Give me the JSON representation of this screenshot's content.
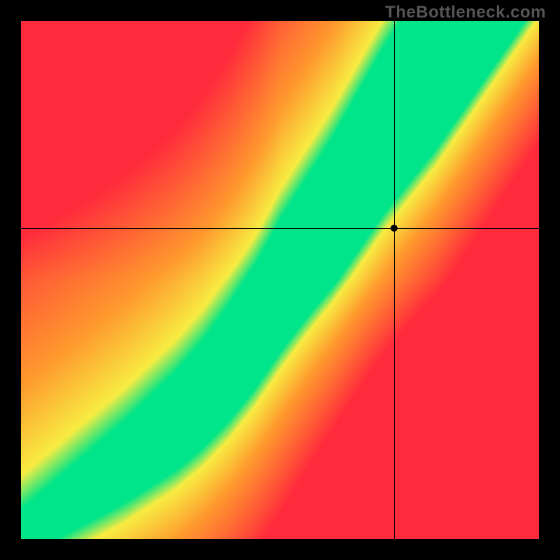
{
  "watermark": "TheBottleneck.com",
  "chart_data": {
    "type": "heatmap",
    "title": "",
    "xlabel": "",
    "ylabel": "",
    "xlim": [
      0,
      100
    ],
    "ylim": [
      0,
      100
    ],
    "grid": false,
    "legend": false,
    "description": "Diagonal green optimal band widening toward upper-right; red/orange away from band; yellow transition.",
    "crosshair": {
      "x": 72,
      "y": 60
    },
    "marker": {
      "x": 72,
      "y": 60
    },
    "optimal_band": {
      "comment": "Approximate centerline of the green band as (x, y) pairs on 0-100 scale, y measured from bottom.",
      "points": [
        [
          0,
          0
        ],
        [
          10,
          7
        ],
        [
          20,
          14
        ],
        [
          30,
          22
        ],
        [
          35,
          27
        ],
        [
          40,
          33
        ],
        [
          45,
          40
        ],
        [
          50,
          48
        ],
        [
          55,
          55
        ],
        [
          60,
          62
        ],
        [
          65,
          70
        ],
        [
          70,
          78
        ],
        [
          75,
          85
        ],
        [
          80,
          92
        ],
        [
          85,
          100
        ]
      ],
      "width_start": 1,
      "width_end": 18
    },
    "color_stops": {
      "match": "#00e589",
      "near": "#f8ec42",
      "mid": "#ff9a2e",
      "far": "#ff2a3c"
    }
  }
}
